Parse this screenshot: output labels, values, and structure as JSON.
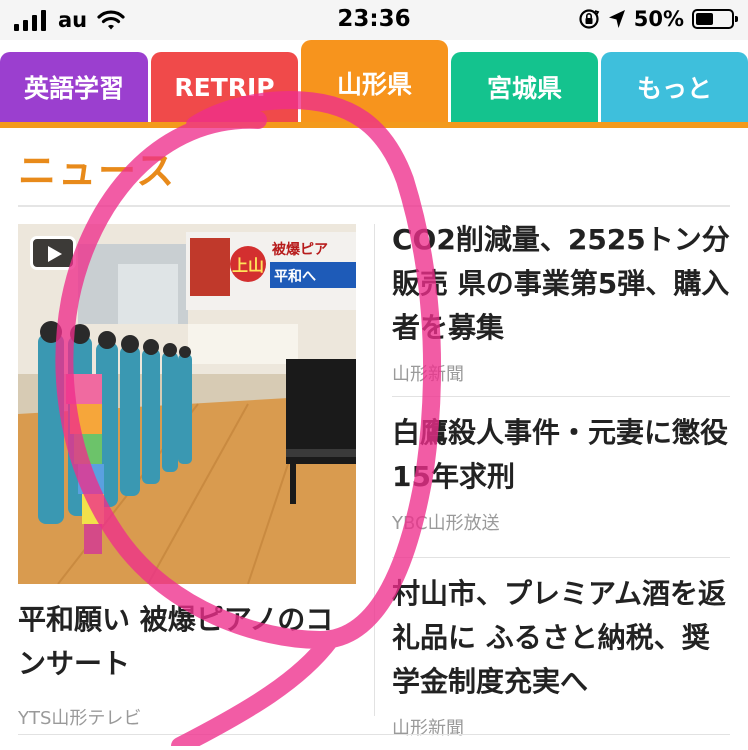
{
  "status_bar": {
    "carrier": "au",
    "time": "23:36",
    "battery_percent": "50%",
    "battery_level": 0.5,
    "icons": [
      "signal-icon",
      "wifi-icon",
      "orientation-lock-icon",
      "location-arrow-icon",
      "battery-icon"
    ]
  },
  "tabs": [
    {
      "label": "英語学習",
      "color": "#9b3fcf",
      "active": false
    },
    {
      "label": "RETRIP",
      "color": "#f04a4a",
      "active": false
    },
    {
      "label": "山形県",
      "color": "#f7941d",
      "active": true
    },
    {
      "label": "宮城県",
      "color": "#14c38e",
      "active": false
    },
    {
      "label": "もっと",
      "color": "#3ebfdc",
      "active": false
    }
  ],
  "section": {
    "title": "ニュース",
    "accent": "#e88a1a"
  },
  "feature": {
    "title": "平和願い 被爆ピアノのコンサート",
    "source": "YTS山形テレビ",
    "has_video": true,
    "thumb_banner_text": "上山",
    "thumb_banner_sub": "被爆ピア",
    "thumb_banner_sub2": "平和へ"
  },
  "news": [
    {
      "title": "CO2削減量、2525トン分販売 県の事業第5弾、購入者を募集",
      "source": "山形新聞"
    },
    {
      "title": "白鷹殺人事件・元妻に懲役15年求刑",
      "source": "YBC山形放送"
    },
    {
      "title": "村山市、プレミアム酒を返礼品に ふるさと納税、奨学金制度充実へ",
      "source": "山形新聞"
    }
  ],
  "colors": {
    "tab_underline": "#f39a1c",
    "doodle": "#ee2e8c"
  }
}
